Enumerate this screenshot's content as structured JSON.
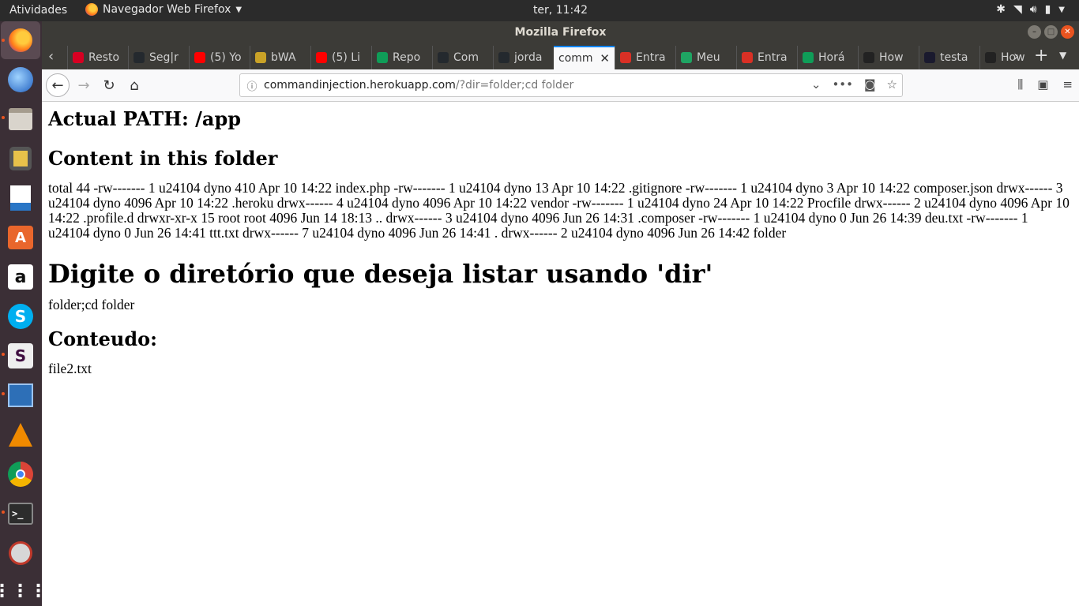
{
  "topbar": {
    "activities": "Atividades",
    "app_name": "Navegador Web Firefox",
    "clock": "ter, 11:42",
    "tray_icons": [
      "bluetooth-icon",
      "wifi-icon",
      "volume-icon",
      "battery-icon",
      "power-menu-icon"
    ]
  },
  "dock": {
    "items": [
      "firefox",
      "thunderbird",
      "files",
      "rhythmbox",
      "libreoffice-writer",
      "ubuntu-software",
      "amazon",
      "skype",
      "slack",
      "system-monitor",
      "vlc",
      "chrome",
      "terminal",
      "screenshot",
      "show-apps"
    ]
  },
  "window": {
    "title": "Mozilla Firefox"
  },
  "tabs": [
    {
      "label": "Resto",
      "icon_color": "#d70022"
    },
    {
      "label": "Seg|r",
      "icon_color": "#24292e"
    },
    {
      "label": "(5) Yo",
      "icon_color": "#ff0000"
    },
    {
      "label": "bWA",
      "icon_color": "#c9a227"
    },
    {
      "label": "(5) Li",
      "icon_color": "#ff0000"
    },
    {
      "label": "Repo",
      "icon_color": "#0f9d58"
    },
    {
      "label": "Com",
      "icon_color": "#24292e"
    },
    {
      "label": "jorda",
      "icon_color": "#24292e"
    },
    {
      "label": "comm",
      "icon_color": "#ffffff",
      "selected": true
    },
    {
      "label": "Entra",
      "icon_color": "#d93025"
    },
    {
      "label": "Meu",
      "icon_color": "#1fa463"
    },
    {
      "label": "Entra",
      "icon_color": "#d93025"
    },
    {
      "label": "Horá",
      "icon_color": "#0f9d58"
    },
    {
      "label": "How",
      "icon_color": "#222222"
    },
    {
      "label": "testa",
      "icon_color": "#1a1a2e"
    },
    {
      "label": "How",
      "icon_color": "#222222"
    }
  ],
  "url": {
    "host": "commandinjection.herokuapp.com",
    "path": "/?dir=folder;cd folder"
  },
  "page": {
    "path_heading": "Actual PATH: /app",
    "content_heading": "Content in this folder",
    "listing": "total 44 -rw------- 1 u24104 dyno 410 Apr 10 14:22 index.php -rw------- 1 u24104 dyno 13 Apr 10 14:22 .gitignore -rw------- 1 u24104 dyno 3 Apr 10 14:22 composer.json drwx------ 3 u24104 dyno 4096 Apr 10 14:22 .heroku drwx------ 4 u24104 dyno 4096 Apr 10 14:22 vendor -rw------- 1 u24104 dyno 24 Apr 10 14:22 Procfile drwx------ 2 u24104 dyno 4096 Apr 10 14:22 .profile.d drwxr-xr-x 15 root root 4096 Jun 14 18:13 .. drwx------ 3 u24104 dyno 4096 Jun 26 14:31 .composer -rw------- 1 u24104 dyno 0 Jun 26 14:39 deu.txt -rw------- 1 u24104 dyno 0 Jun 26 14:41 ttt.txt drwx------ 7 u24104 dyno 4096 Jun 26 14:41 . drwx------ 2 u24104 dyno 4096 Jun 26 14:42 folder",
    "prompt_heading": "Digite o diretório que deseja listar usando 'dir'",
    "dir_value": "folder;cd folder",
    "result_heading": "Conteudo:",
    "result_value": "file2.txt"
  }
}
